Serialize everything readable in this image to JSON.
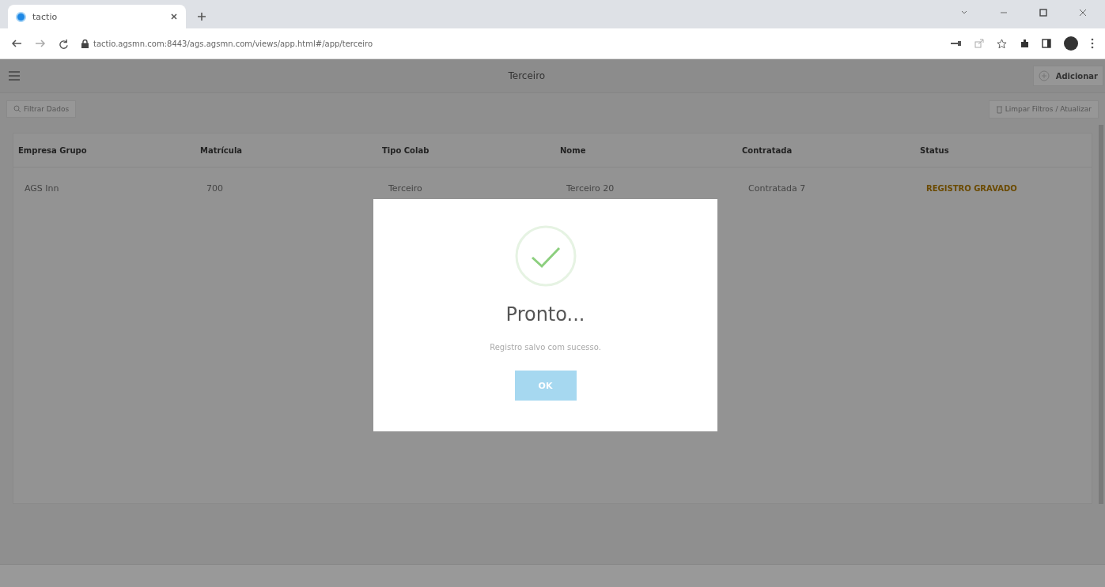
{
  "browser": {
    "tab_title": "tactio",
    "url": "tactio.agsmn.com:8443/ags.agsmn.com/views/app.html#/app/terceiro"
  },
  "header": {
    "title": "Terceiro",
    "add_button": "Adicionar"
  },
  "filter_bar": {
    "filter_button": "Filtrar Dados",
    "refresh_button": "Limpar Filtros / Atualizar"
  },
  "table": {
    "columns": [
      "Empresa Grupo",
      "Matrícula",
      "Tipo Colab",
      "Nome",
      "Contratada",
      "Status"
    ],
    "rows": [
      {
        "cells": [
          "AGS Inn",
          "700",
          "Terceiro",
          "Terceiro 20",
          "Contratada 7"
        ],
        "status": "REGISTRO GRAVADO"
      }
    ]
  },
  "dialog": {
    "title": "Pronto...",
    "message": "Registro salvo com sucesso.",
    "button": "OK"
  }
}
